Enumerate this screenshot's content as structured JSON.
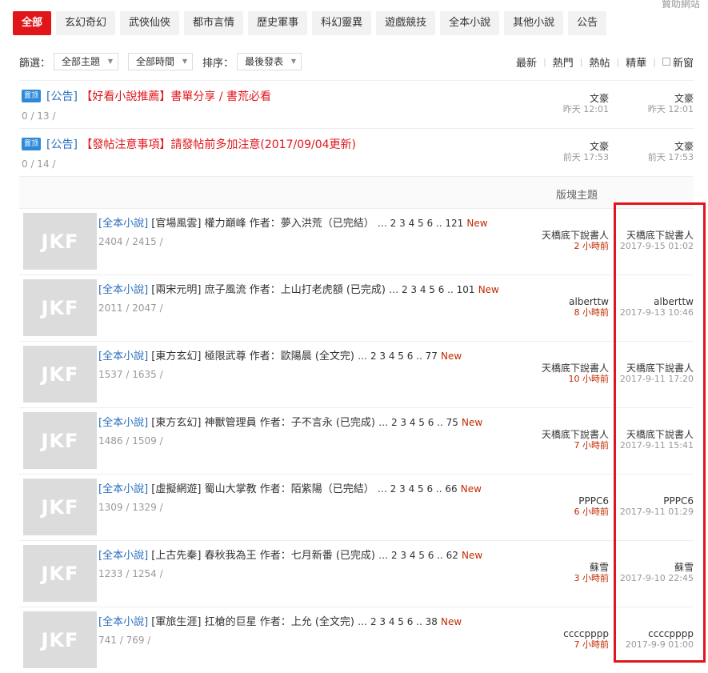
{
  "sponsor": "贊助網站",
  "tabs": [
    {
      "label": "全部",
      "active": true
    },
    {
      "label": "玄幻奇幻"
    },
    {
      "label": "武俠仙俠"
    },
    {
      "label": "都市言情"
    },
    {
      "label": "歷史軍事"
    },
    {
      "label": "科幻靈異"
    },
    {
      "label": "遊戲競技"
    },
    {
      "label": "全本小說"
    },
    {
      "label": "其他小說"
    },
    {
      "label": "公告"
    }
  ],
  "filter": {
    "label1": "篩選：",
    "topic": "全部主題",
    "time": "全部時間",
    "label2": "排序：",
    "order": "最後發表",
    "sorts": [
      "最新",
      "熱門",
      "熱帖",
      "精華"
    ],
    "newwin": "新窗"
  },
  "notices": [
    {
      "tag": "置顶",
      "cat": "[公告]",
      "title": "【好看小說推薦】書單分享 / 書荒必看",
      "counts": "0 / 13 /",
      "author": "文豪",
      "author_time": "昨天 12:01",
      "last": "文豪",
      "last_time": "昨天 12:01"
    },
    {
      "tag": "置顶",
      "cat": "[公告]",
      "title": "【發帖注意事項】請發帖前多加注意(2017/09/04更新)",
      "counts": "0 / 14 /",
      "author": "文豪",
      "author_time": "前天 17:53",
      "last": "文豪",
      "last_time": "前天 17:53"
    }
  ],
  "section_title": "版塊主題",
  "thumb_text": "JKF",
  "rows": [
    {
      "cat": "[全本小說]",
      "title": "[官場風雲] 權力巔峰 作者：夢入洪荒（已完結）",
      "pages": "… 2  3  4  5  6 .. 121",
      "newtag": "New",
      "counts": "2404 / 2415 /",
      "author": "天橋底下說書人",
      "author_time": "2 小時前",
      "last": "天橋底下說書人",
      "last_time": "2017-9-15 01:02"
    },
    {
      "cat": "[全本小說]",
      "title": "[兩宋元明] 庶子風流 作者：上山打老虎額 (已完成)",
      "pages": "… 2  3  4  5  6 .. 101",
      "newtag": "New",
      "counts": "2011 / 2047 /",
      "author": "alberttw",
      "author_time": "8 小時前",
      "last": "alberttw",
      "last_time": "2017-9-13 10:46"
    },
    {
      "cat": "[全本小說]",
      "title": "[東方玄幻] 極限武尊 作者：歐陽晨 (全文完)",
      "pages": "… 2  3  4  5  6 .. 77",
      "newtag": "New",
      "counts": "1537 / 1635 /",
      "author": "天橋底下說書人",
      "author_time": "10 小時前",
      "last": "天橋底下說書人",
      "last_time": "2017-9-11 17:20"
    },
    {
      "cat": "[全本小說]",
      "title": "[東方玄幻] 神獸管理員 作者：子不言永 (已完成)",
      "pages": "… 2  3  4  5  6 .. 75",
      "newtag": "New",
      "counts": "1486 / 1509 /",
      "author": "天橋底下說書人",
      "author_time": "7 小時前",
      "last": "天橋底下說書人",
      "last_time": "2017-9-11 15:41"
    },
    {
      "cat": "[全本小說]",
      "title": "[虛擬網遊] 蜀山大掌教 作者：陌紫陽（已完結）",
      "pages": "… 2  3  4  5  6 .. 66",
      "newtag": "New",
      "counts": "1309 / 1329 /",
      "author": "PPPC6",
      "author_time": "6 小時前",
      "last": "PPPC6",
      "last_time": "2017-9-11 01:29"
    },
    {
      "cat": "[全本小說]",
      "title": "[上古先秦] 春秋我為王 作者：七月新番 (已完成)",
      "pages": "… 2  3  4  5  6 .. 62",
      "newtag": "New",
      "counts": "1233 / 1254 /",
      "author": "蘇雪",
      "author_time": "3 小時前",
      "last": "蘇雪",
      "last_time": "2017-9-10 22:45"
    },
    {
      "cat": "[全本小說]",
      "title": "[軍旅生涯] 扛槍的巨星 作者：上允 (全文完)",
      "pages": "… 2  3  4  5  6 .. 38",
      "newtag": "New",
      "counts": "741 / 769 /",
      "author": "ccccpppp",
      "author_time": "7 小時前",
      "last": "ccccpppp",
      "last_time": "2017-9-9 01:00"
    }
  ],
  "colors": {
    "brand": "#e0161b",
    "link": "#2a6ebd",
    "time_red": "#c02a00"
  }
}
